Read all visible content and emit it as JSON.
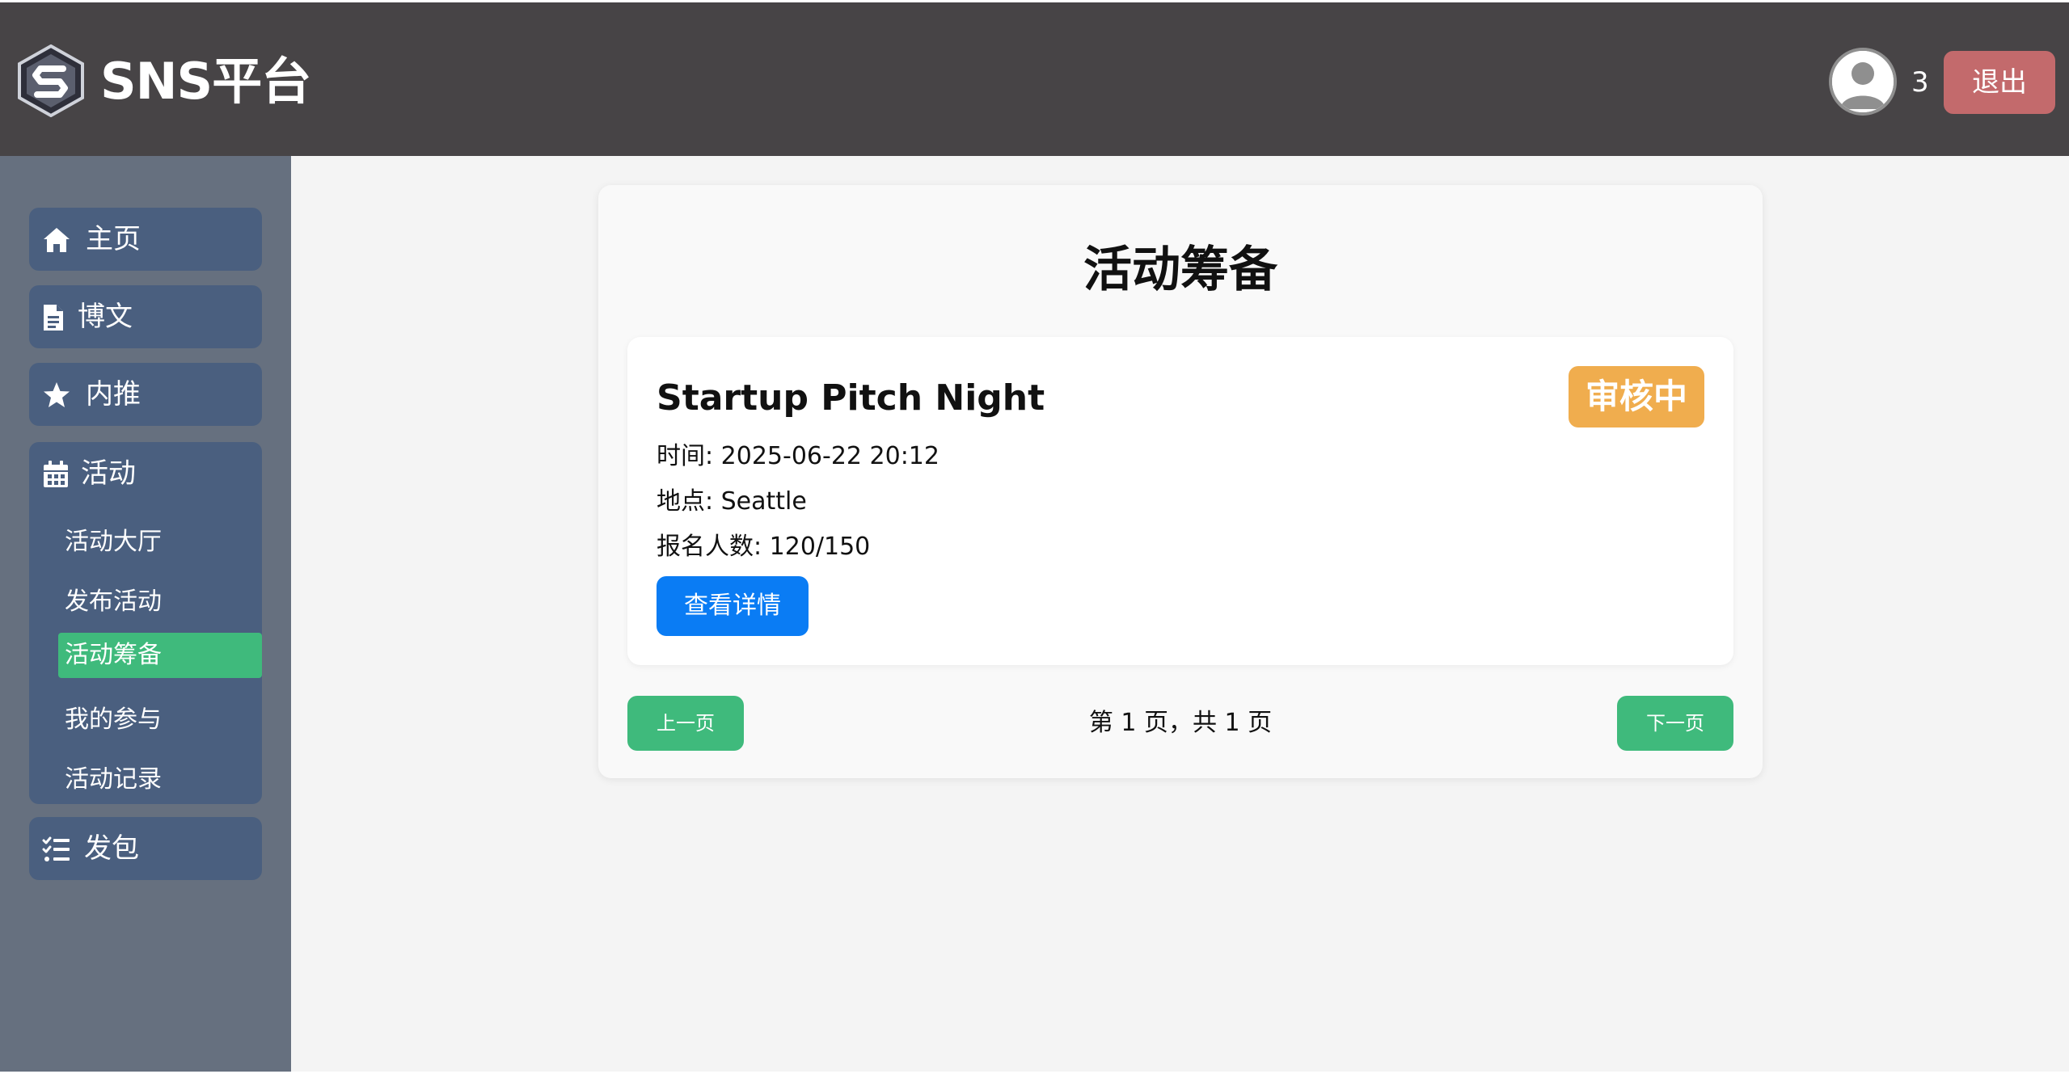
{
  "header": {
    "brand": "SNS平台",
    "logo_icon": "sns-logo",
    "user_count": "3",
    "logout_label": "退出"
  },
  "sidebar": {
    "items": [
      {
        "label": "主页",
        "icon": "home-icon"
      },
      {
        "label": "博文",
        "icon": "file-icon"
      },
      {
        "label": "内推",
        "icon": "star-icon"
      },
      {
        "label": "发包",
        "icon": "list-check-icon"
      }
    ],
    "activity_group": {
      "label": "活动",
      "icon": "calendar-icon",
      "children": [
        {
          "label": "活动大厅"
        },
        {
          "label": "发布活动"
        },
        {
          "label": "活动筹备"
        },
        {
          "label": "我的参与"
        },
        {
          "label": "活动记录"
        }
      ],
      "active_child": "活动筹备"
    }
  },
  "main": {
    "title": "活动筹备",
    "cards": [
      {
        "title": "Startup Pitch Night",
        "status": "审核中",
        "time": "时间: 2025-06-22 20:12",
        "location": "地点: Seattle",
        "signups": "报名人数: 120/150",
        "detail_label": "查看详情"
      }
    ],
    "pagination": {
      "prev_label": "上一页",
      "next_label": "下一页",
      "status": "第 1 页，共 1 页"
    }
  },
  "colors": {
    "topbar": "#474446",
    "sidebar": "#66707f",
    "nav_item": "#4a5f7f",
    "active": "#3fba7c",
    "logout": "#c36a6c",
    "badge": "#f0ad4e",
    "primary": "#0a7cf4"
  }
}
